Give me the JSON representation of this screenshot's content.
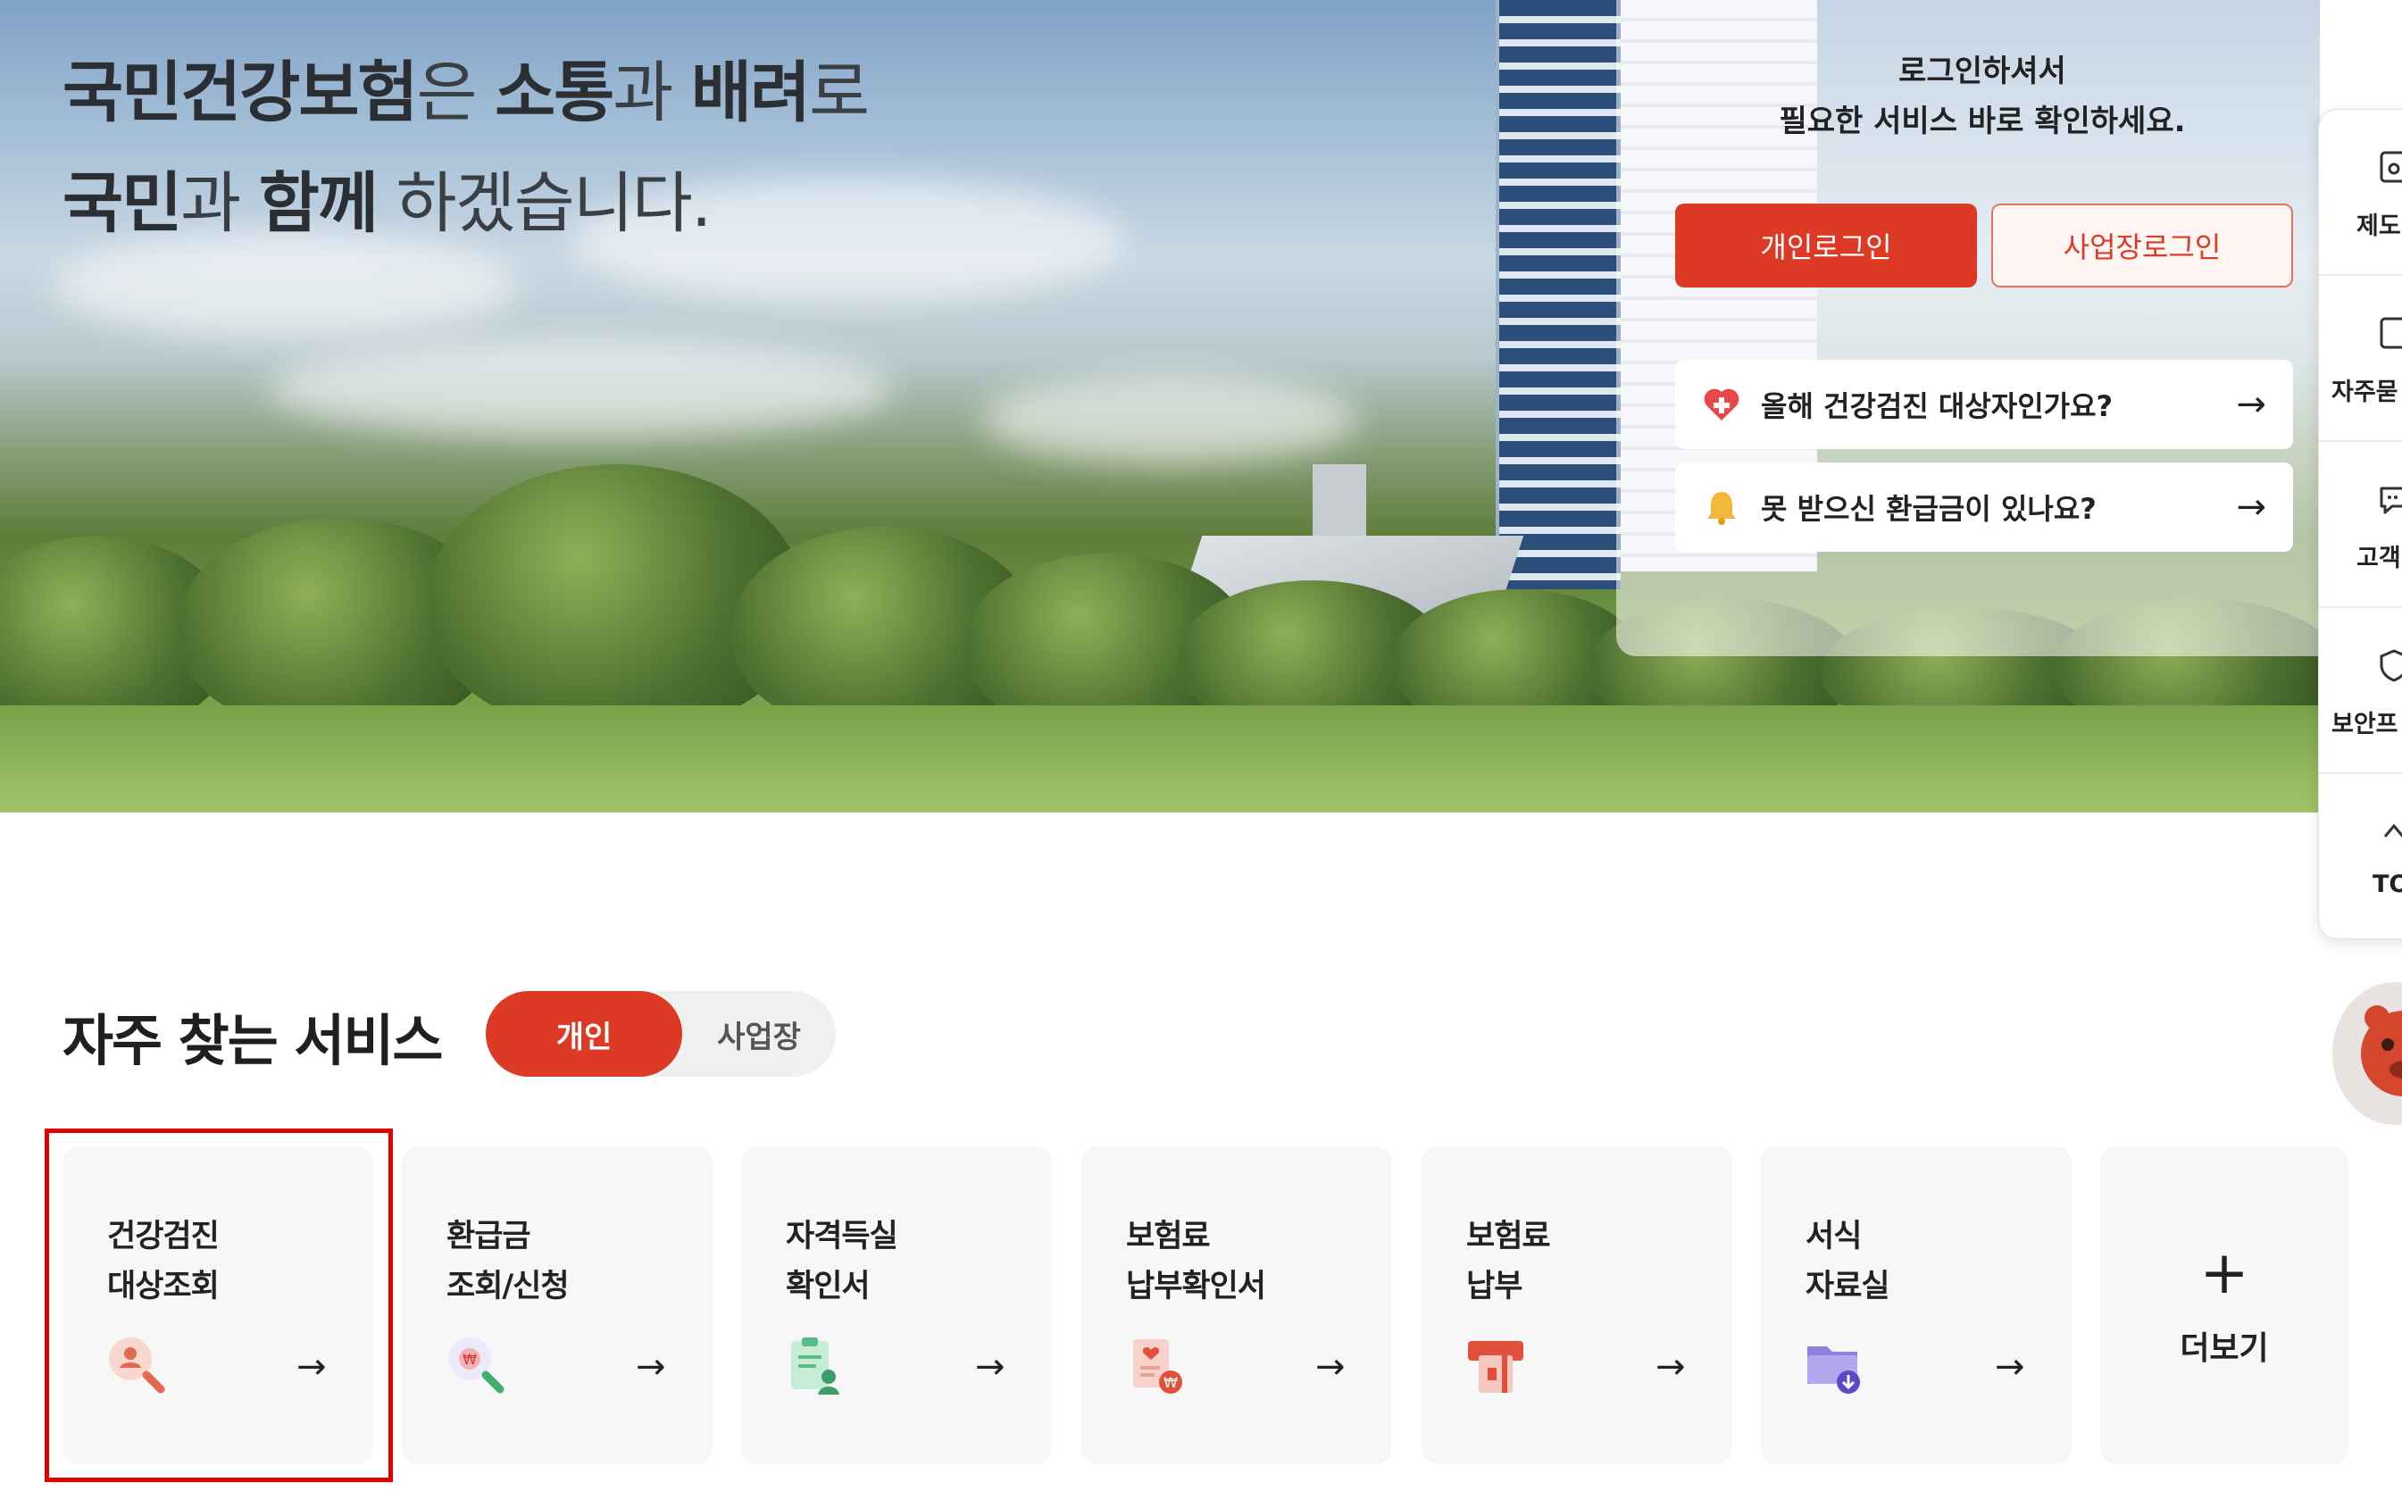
{
  "hero": {
    "title_line1": [
      {
        "text": "국민건강보험",
        "bold": true
      },
      {
        "text": "은 ",
        "bold": false
      },
      {
        "text": "소통",
        "bold": true
      },
      {
        "text": "과 ",
        "bold": false
      },
      {
        "text": "배려",
        "bold": true
      },
      {
        "text": "로",
        "bold": false
      }
    ],
    "title_line2": [
      {
        "text": "국민",
        "bold": true
      },
      {
        "text": "과 ",
        "bold": false
      },
      {
        "text": "함께",
        "bold": true
      },
      {
        "text": " 하겠습니다.",
        "bold": false
      }
    ]
  },
  "login": {
    "message_line1": "로그인하셔서",
    "message_line2": "필요한 서비스 바로 확인하세요.",
    "personal_login": "개인로그인",
    "business_login": "사업장로그인",
    "quick_links": [
      {
        "label": "올해 건강검진 대상자인가요?",
        "icon": "heart-plus-icon",
        "arrow": "→"
      },
      {
        "label": "못 받으신 환급금이 있나요?",
        "icon": "bell-icon",
        "arrow": "→"
      }
    ]
  },
  "rail": {
    "items": [
      {
        "label": "제도",
        "icon": "document-icon"
      },
      {
        "label": "자주묻",
        "icon": "faq-icon"
      },
      {
        "label": "고객",
        "icon": "chat-icon"
      },
      {
        "label": "보안프",
        "icon": "shield-icon"
      },
      {
        "label": "TO",
        "icon": "chevron-up-icon"
      }
    ],
    "mascot_icon": "mascot-chatbot-icon"
  },
  "services": {
    "title": "자주 찾는 서비스",
    "tab_personal": "개인",
    "tab_business": "사업장",
    "cards": [
      {
        "line1": "건강검진",
        "line2": "대상조회",
        "icon": "person-search-icon",
        "arrow": "→"
      },
      {
        "line1": "환급금",
        "line2": "조회/신청",
        "icon": "won-search-icon",
        "arrow": "→"
      },
      {
        "line1": "자격득실",
        "line2": "확인서",
        "icon": "clipboard-person-icon",
        "arrow": "→"
      },
      {
        "line1": "보험료",
        "line2": "납부확인서",
        "icon": "receipt-won-icon",
        "arrow": "→"
      },
      {
        "line1": "보험료",
        "line2": "납부",
        "icon": "card-payment-icon",
        "arrow": "→"
      },
      {
        "line1": "서식",
        "line2": "자료실",
        "icon": "folder-download-icon",
        "arrow": "→"
      }
    ],
    "more_symbol": "+",
    "more_label": "더보기"
  },
  "colors": {
    "accent": "#dd3a26",
    "highlight_box": "#e00000",
    "card_bg": "#f7f7f7"
  }
}
